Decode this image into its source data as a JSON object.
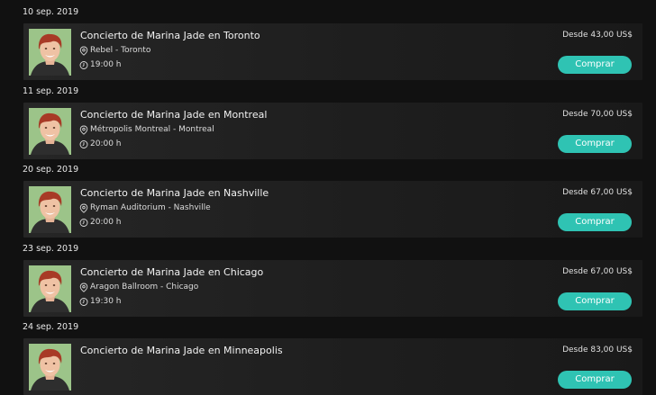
{
  "events": [
    {
      "date": "10 sep. 2019",
      "title": "Concierto de Marina Jade en Toronto",
      "venue": "Rebel - Toronto",
      "time": "19:00 h",
      "price": "Desde 43,00 US$",
      "button_label": "Comprar"
    },
    {
      "date": "11 sep. 2019",
      "title": "Concierto de Marina Jade en Montreal",
      "venue": "Métropolis Montreal - Montreal",
      "time": "20:00 h",
      "price": "Desde 70,00 US$",
      "button_label": "Comprar"
    },
    {
      "date": "20 sep. 2019",
      "title": "Concierto de Marina Jade en Nashville",
      "venue": "Ryman Auditorium - Nashville",
      "time": "20:00 h",
      "price": "Desde 67,00 US$",
      "button_label": "Comprar"
    },
    {
      "date": "23 sep. 2019",
      "title": "Concierto de Marina Jade en Chicago",
      "venue": "Aragon Ballroom - Chicago",
      "time": "19:30 h",
      "price": "Desde 67,00 US$",
      "button_label": "Comprar"
    },
    {
      "date": "24 sep. 2019",
      "title": "Concierto de Marina Jade en Minneapolis",
      "venue": "",
      "time": "",
      "price": "Desde 83,00 US$",
      "button_label": "Comprar"
    }
  ],
  "icons": {
    "venue": "map-pin-icon",
    "time": "clock-icon"
  },
  "colors": {
    "background": "#111111",
    "card": "#222222",
    "accent": "#2fc3b3",
    "photo_bg": "#9cc489"
  }
}
